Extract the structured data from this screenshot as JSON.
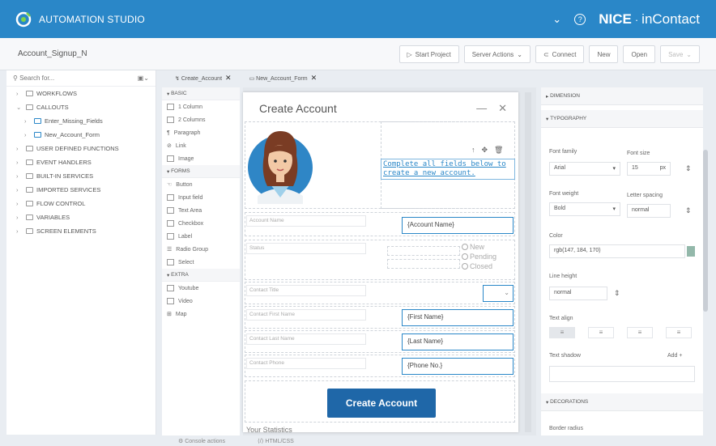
{
  "header": {
    "app_title": "AUTOMATION STUDIO",
    "brand": "NICE",
    "brand_sep": "·",
    "brand_sub": "inContact"
  },
  "toolbar": {
    "project_name": "Account_Signup_N",
    "start_project": "Start Project",
    "server_actions": "Server Actions",
    "connect": "Connect",
    "new": "New",
    "open": "Open",
    "save": "Save"
  },
  "left_panel": {
    "search_placeholder": "Search for...",
    "items": [
      {
        "label": "WORKFLOWS",
        "caret": "›"
      },
      {
        "label": "CALLOUTS",
        "caret": "⌄"
      },
      {
        "label": "Enter_Missing_Fields",
        "caret": "›"
      },
      {
        "label": "New_Account_Form",
        "caret": "›"
      },
      {
        "label": "USER DEFINED FUNCTIONS",
        "caret": "›"
      },
      {
        "label": "EVENT HANDLERS",
        "caret": "›"
      },
      {
        "label": "BUILT-IN SERVICES",
        "caret": "›"
      },
      {
        "label": "IMPORTED SERVICES",
        "caret": "›"
      },
      {
        "label": "FLOW CONTROL",
        "caret": "›"
      },
      {
        "label": "VARIABLES",
        "caret": "›"
      },
      {
        "label": "SCREEN ELEMENTS",
        "caret": "›"
      }
    ]
  },
  "tabs": [
    {
      "label": "Create_Account"
    },
    {
      "label": "New_Account_Form"
    }
  ],
  "palette": {
    "basic": "BASIC",
    "basic_items": [
      "1 Column",
      "2 Columns",
      "Paragraph",
      "Link",
      "Image"
    ],
    "forms": "FORMS",
    "forms_items": [
      "Button",
      "Input field",
      "Text Area",
      "Checkbox",
      "Label",
      "Radio Group",
      "Select"
    ],
    "extra": "EXTRA",
    "extra_items": [
      "Youtube",
      "Video",
      "Map"
    ]
  },
  "form": {
    "title": "Create Account",
    "minimize": "—",
    "close": "✕",
    "instruction": "Complete all fields below to create a new account.",
    "account_name_label": "Account Name",
    "account_name_value": "{Account Name}",
    "status_label": "Status",
    "radio_new": "New",
    "radio_pending": "Pending",
    "radio_closed": "Closed",
    "contact_title_label": "Contact Title",
    "contact_first_label": "Contact First Name",
    "first_name_value": "{First Name}",
    "contact_last_label": "Contact Last Name",
    "last_name_value": "{Last Name}",
    "contact_phone_label": "Contact Phone",
    "phone_value": "{Phone No.}",
    "create_button": "Create Account",
    "statistics": "Your Statistics"
  },
  "right_panel": {
    "dimension": "DIMENSION",
    "typography": "TYPOGRAPHY",
    "font_family_label": "Font family",
    "font_family_value": "Arial",
    "font_size_label": "Font size",
    "font_size_value": "15",
    "font_size_unit": "px",
    "font_weight_label": "Font weight",
    "font_weight_value": "Bold",
    "letter_spacing_label": "Letter spacing",
    "letter_spacing_value": "normal",
    "color_label": "Color",
    "color_value": "rgb(147, 184, 170)",
    "color_swatch": "#93b8aa",
    "line_height_label": "Line height",
    "line_height_value": "normal",
    "text_align_label": "Text align",
    "text_shadow_label": "Text shadow",
    "text_shadow_add": "Add",
    "decorations": "DECORATIONS",
    "border_radius_label": "Border radius"
  },
  "bottom": {
    "console": "Console actions",
    "html": "HTML/CSS"
  },
  "colors": {
    "brand_blue": "#2a87c8",
    "button_blue": "#1f67a8"
  }
}
